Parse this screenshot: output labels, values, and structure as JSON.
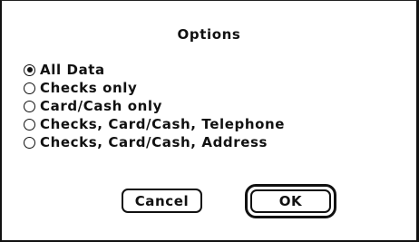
{
  "dialog": {
    "title": "Options",
    "options": [
      {
        "label": "All Data",
        "selected": true
      },
      {
        "label": "Checks only",
        "selected": false
      },
      {
        "label": "Card/Cash only",
        "selected": false
      },
      {
        "label": "Checks, Card/Cash, Telephone",
        "selected": false
      },
      {
        "label": "Checks, Card/Cash, Address",
        "selected": false
      }
    ],
    "cancel_label": "Cancel",
    "ok_label": "OK",
    "default_button": "ok"
  }
}
